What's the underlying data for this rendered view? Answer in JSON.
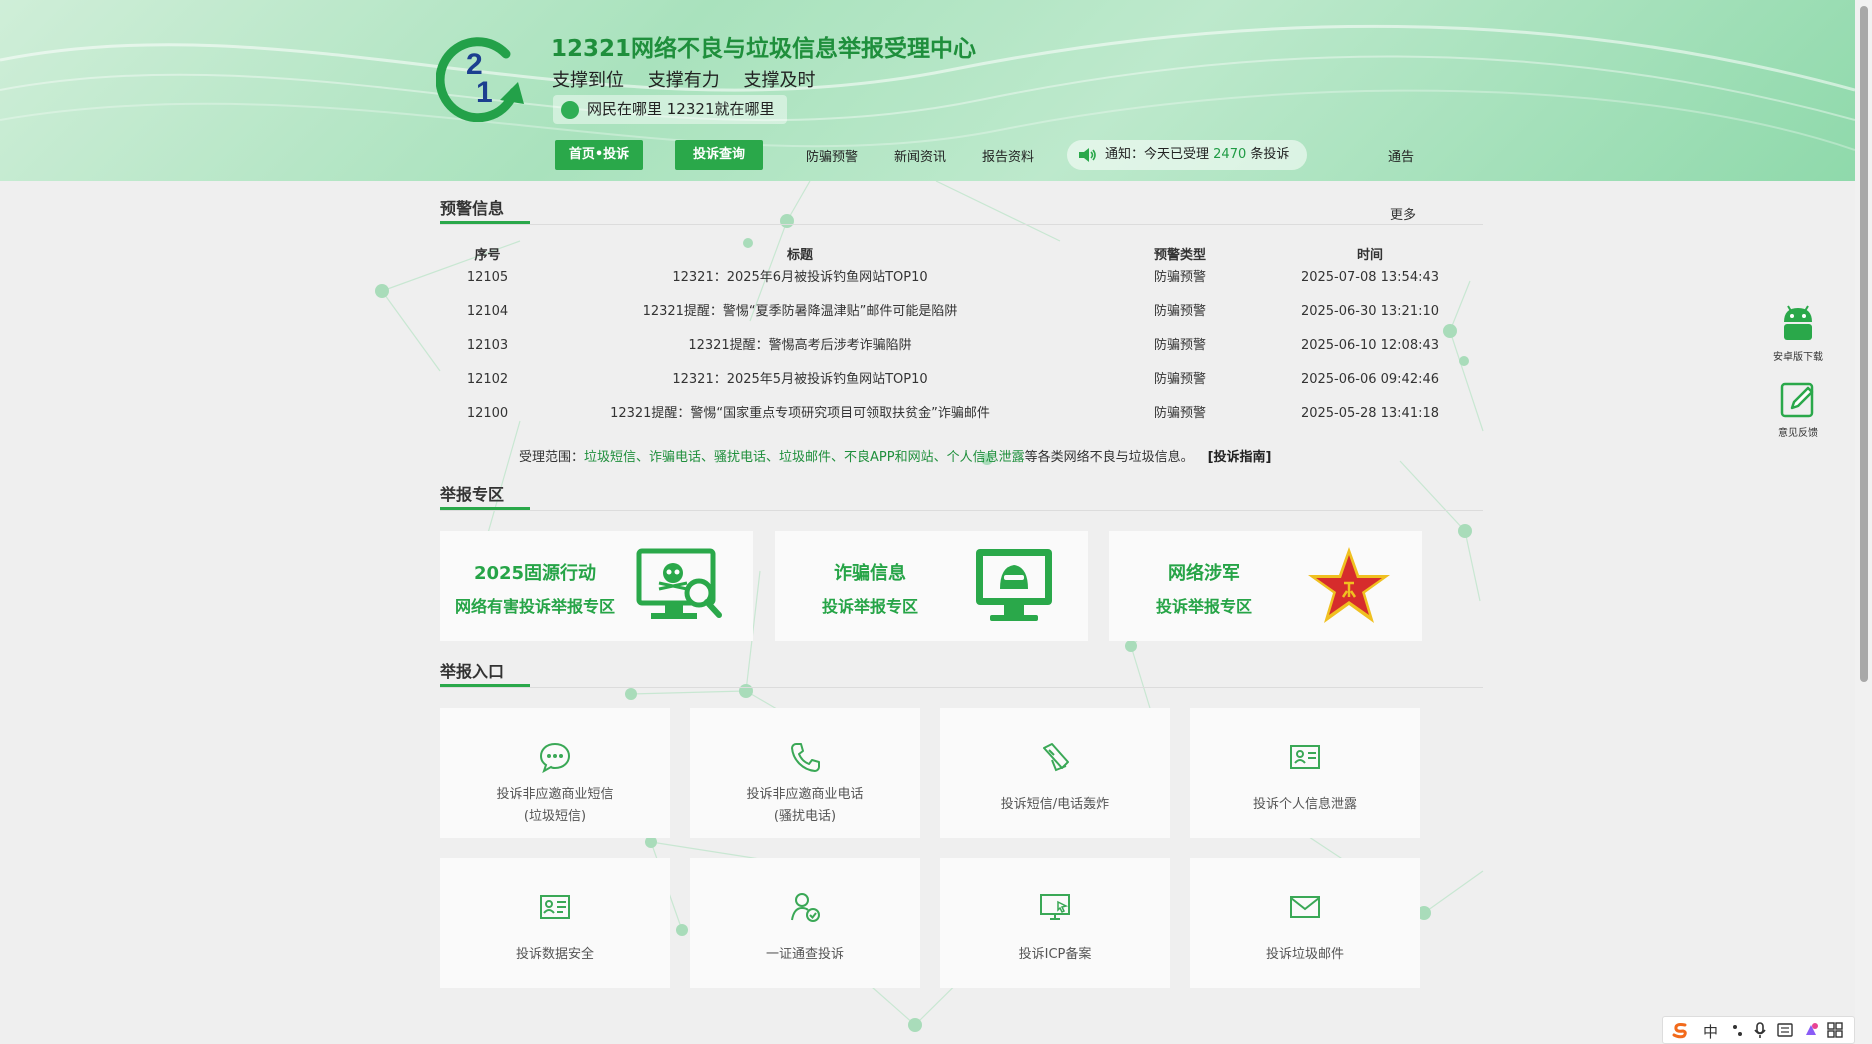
{
  "header": {
    "site_title": "12321网络不良与垃圾信息举报受理中心",
    "slogans": [
      "支撑到位",
      "支撑有力",
      "支撑及时"
    ],
    "motto": "网民在哪里 12321就在哪里",
    "nav": {
      "home_btn": "首页•投诉",
      "query_btn": "投诉查询",
      "links": [
        "防骗预警",
        "新闻资讯",
        "报告资料"
      ]
    },
    "notice": {
      "prefix": "通知：今天已受理",
      "count": "2470",
      "suffix": "条投诉",
      "right_link": "通告"
    }
  },
  "warning": {
    "heading": "预警信息",
    "more": "更多",
    "columns": [
      "序号",
      "标题",
      "预警类型",
      "时间"
    ],
    "rows": [
      {
        "no": "12105",
        "title": "12321：2025年6月被投诉钓鱼网站TOP10",
        "type": "防骗预警",
        "time": "2025-07-08 13:54:43"
      },
      {
        "no": "12104",
        "title": "12321提醒：警惕“夏季防暑降温津贴”邮件可能是陷阱",
        "type": "防骗预警",
        "time": "2025-06-30 13:21:10"
      },
      {
        "no": "12103",
        "title": "12321提醒：警惕高考后涉考诈骗陷阱",
        "type": "防骗预警",
        "time": "2025-06-10 12:08:43"
      },
      {
        "no": "12102",
        "title": "12321：2025年5月被投诉钓鱼网站TOP10",
        "type": "防骗预警",
        "time": "2025-06-06 09:42:46"
      },
      {
        "no": "12100",
        "title": "12321提醒：警惕“国家重点专项研究项目可领取扶贫金”诈骗邮件",
        "type": "防骗预警",
        "time": "2025-05-28 13:41:18"
      }
    ],
    "scope": {
      "prefix": "受理范围：",
      "items": "垃圾短信、诈骗电话、骚扰电话、垃圾邮件、不良APP和网站、个人信息泄露",
      "suffix": "等各类网络不良与垃圾信息。",
      "guide": "[投诉指南]"
    }
  },
  "report_zone": {
    "heading": "举报专区",
    "cards": [
      {
        "line1": "2025固源行动",
        "line2": "网络有害投诉举报专区",
        "icon": "monitor-skull-search-icon"
      },
      {
        "line1": "诈骗信息",
        "line2": "投诉举报专区",
        "icon": "monitor-hacker-icon"
      },
      {
        "line1": "网络涉军",
        "line2": "投诉举报专区",
        "icon": "military-star-icon"
      }
    ]
  },
  "entry": {
    "heading": "举报入口",
    "tiles": [
      {
        "line1": "投诉非应邀商业短信",
        "line2": "(垃圾短信)",
        "icon": "chat-bubble-icon"
      },
      {
        "line1": "投诉非应邀商业电话",
        "line2": "(骚扰电话)",
        "icon": "phone-icon"
      },
      {
        "line1": "投诉短信/电话轰炸",
        "line2": "",
        "icon": "bomb-icon"
      },
      {
        "line1": "投诉个人信息泄露",
        "line2": "",
        "icon": "id-card-icon"
      },
      {
        "line1": "投诉数据安全",
        "line2": "",
        "icon": "data-card-icon"
      },
      {
        "line1": "一证通查投诉",
        "line2": "",
        "icon": "user-check-icon"
      },
      {
        "line1": "投诉ICP备案",
        "line2": "",
        "icon": "monitor-cursor-icon"
      },
      {
        "line1": "投诉垃圾邮件",
        "line2": "",
        "icon": "mail-icon"
      }
    ]
  },
  "float": {
    "android": "安卓版下载",
    "feedback": "意见反馈"
  },
  "ime": {
    "lang": "中"
  },
  "colors": {
    "brand_green": "#2aa84a",
    "title_green": "#1f8f3c",
    "star_red": "#d62c2c",
    "star_gold": "#f0c020"
  }
}
